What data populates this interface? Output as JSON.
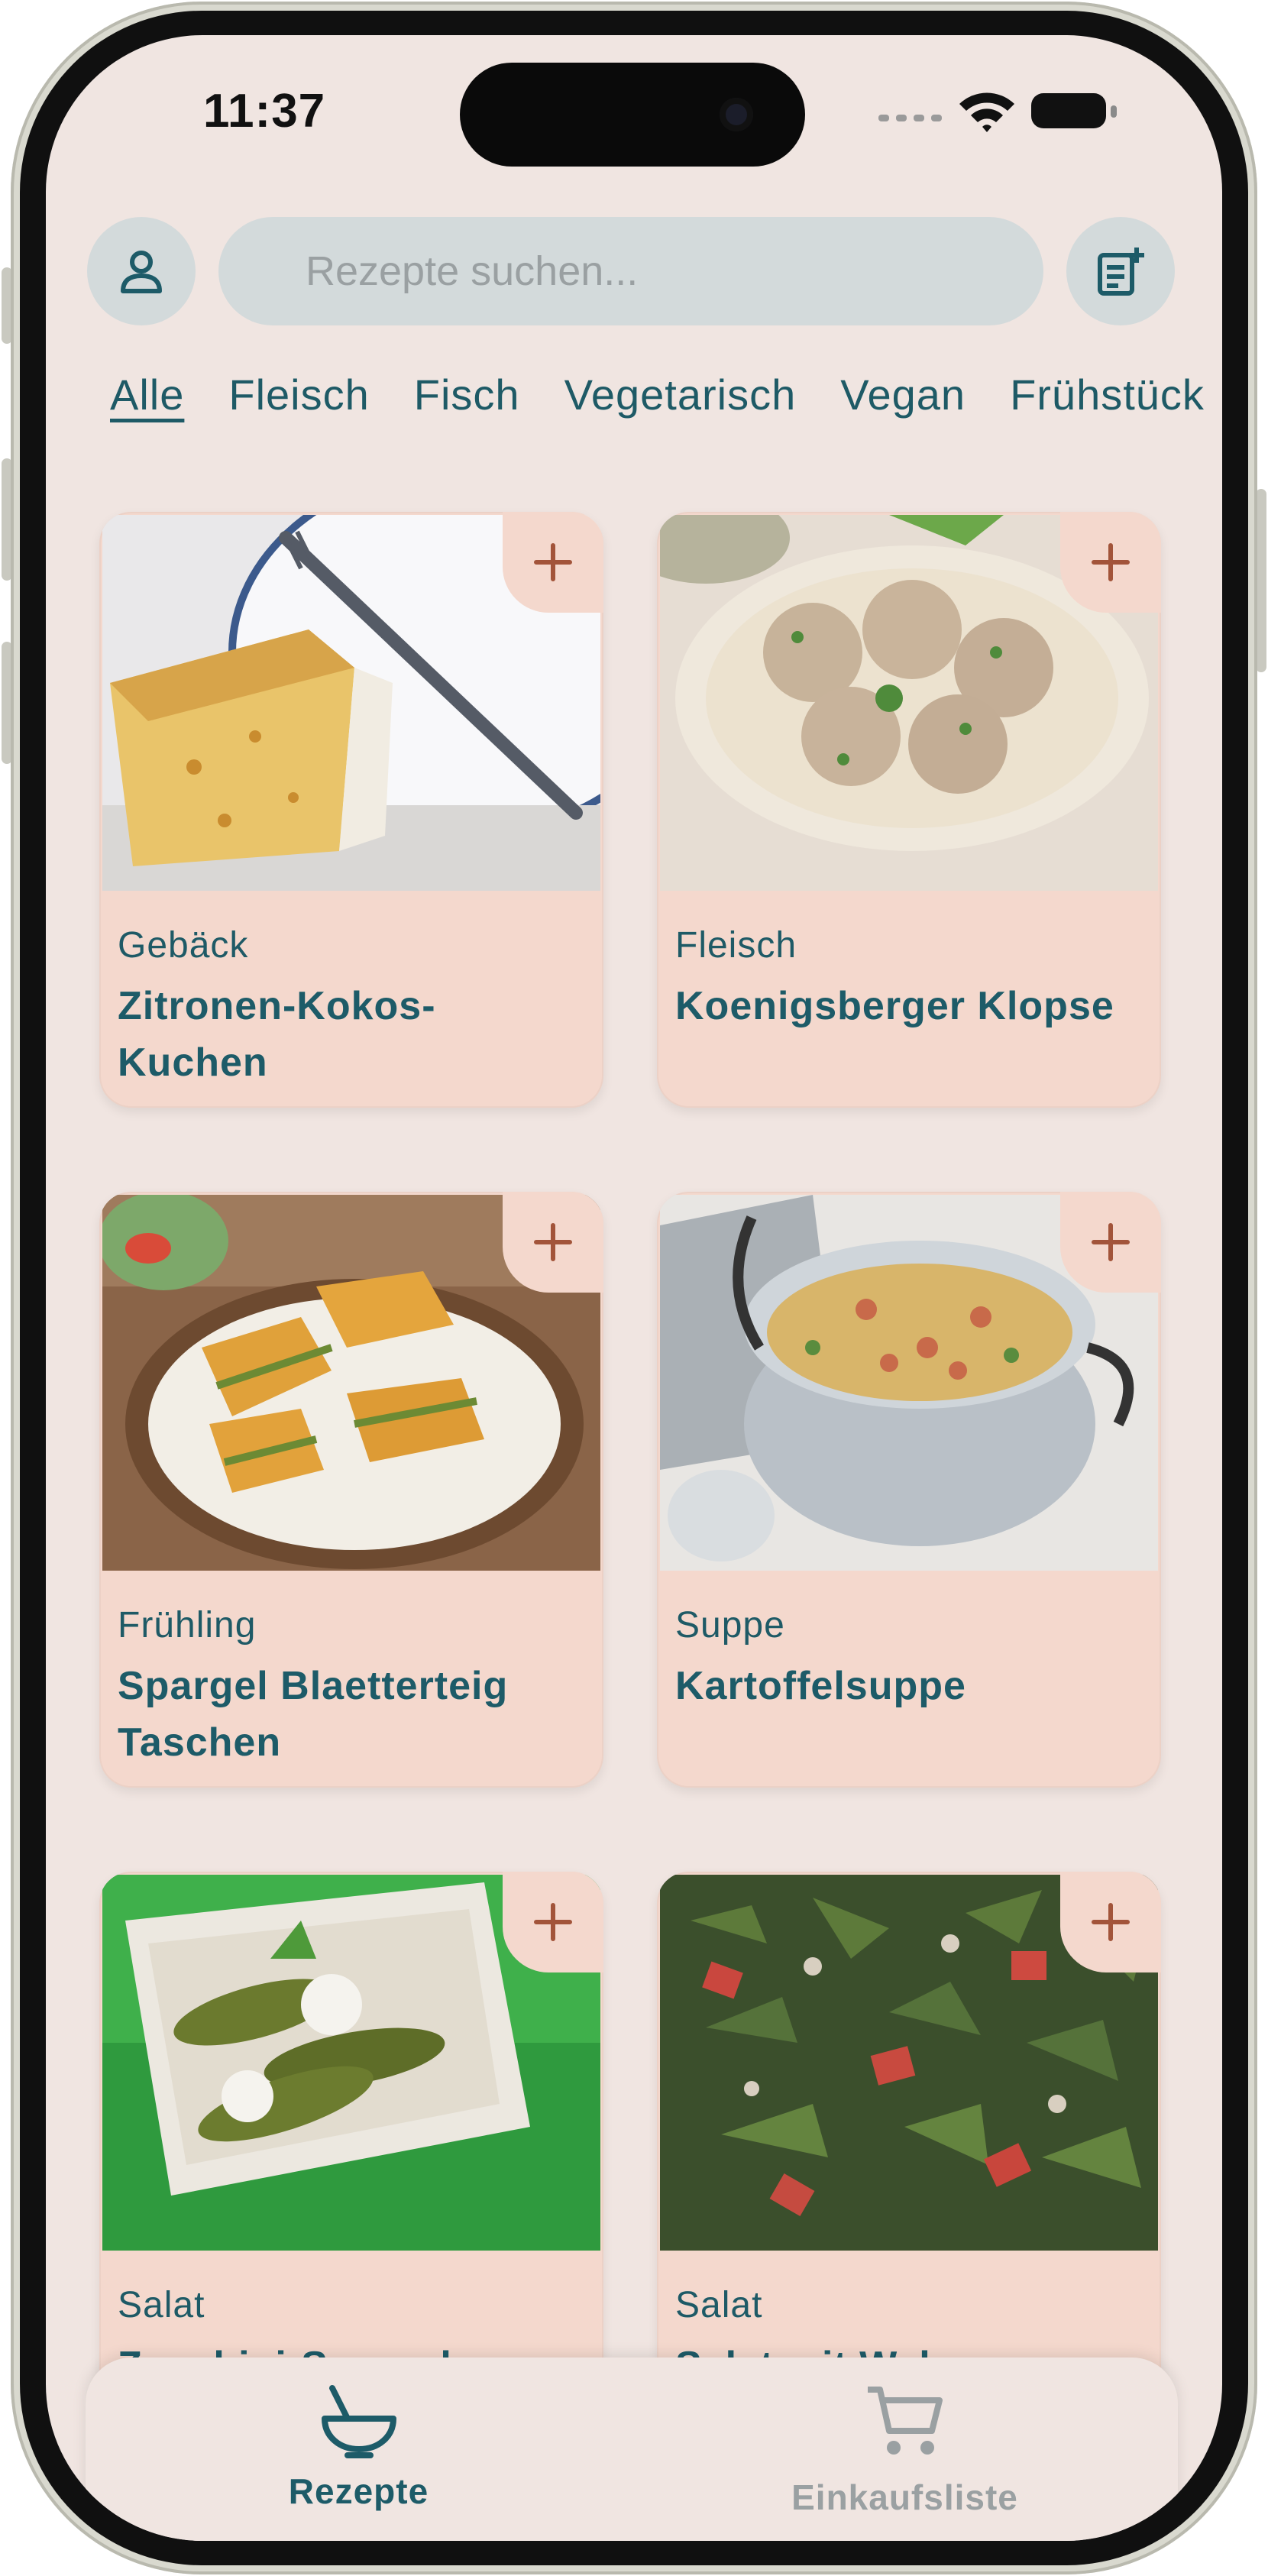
{
  "status_bar": {
    "time": "11:37"
  },
  "header": {
    "search_placeholder": "Rezepte suchen..."
  },
  "categories": [
    "Alle",
    "Fleisch",
    "Fisch",
    "Vegetarisch",
    "Vegan",
    "Frühstück"
  ],
  "active_category": "Alle",
  "recipes": [
    {
      "category": "Gebäck",
      "title": "Zitronen-Kokos-Kuchen"
    },
    {
      "category": "Fleisch",
      "title": "Koenigsberger Klopse"
    },
    {
      "category": "Frühling",
      "title": "Spargel Blaetterteig Taschen"
    },
    {
      "category": "Suppe",
      "title": "Kartoffelsuppe"
    },
    {
      "category": "Salat",
      "title": "Zucchini-Spargel-"
    },
    {
      "category": "Salat",
      "title": "Salat mit Walnuessen"
    }
  ],
  "bottom_nav": {
    "recipes_label": "Rezepte",
    "shopping_label": "Einkaufsliste",
    "active": "Rezepte"
  },
  "colors": {
    "background": "#f0e5e1",
    "card": "#f4d8cd",
    "accent_teal": "#1d5b68",
    "plus_brown": "#a2543a",
    "inactive_gray": "#9aa0a2"
  },
  "icons": {
    "profile": "person-icon",
    "add_list": "note-add-icon",
    "plus": "plus-icon",
    "recipes": "bowl-icon",
    "shopping": "cart-icon"
  }
}
